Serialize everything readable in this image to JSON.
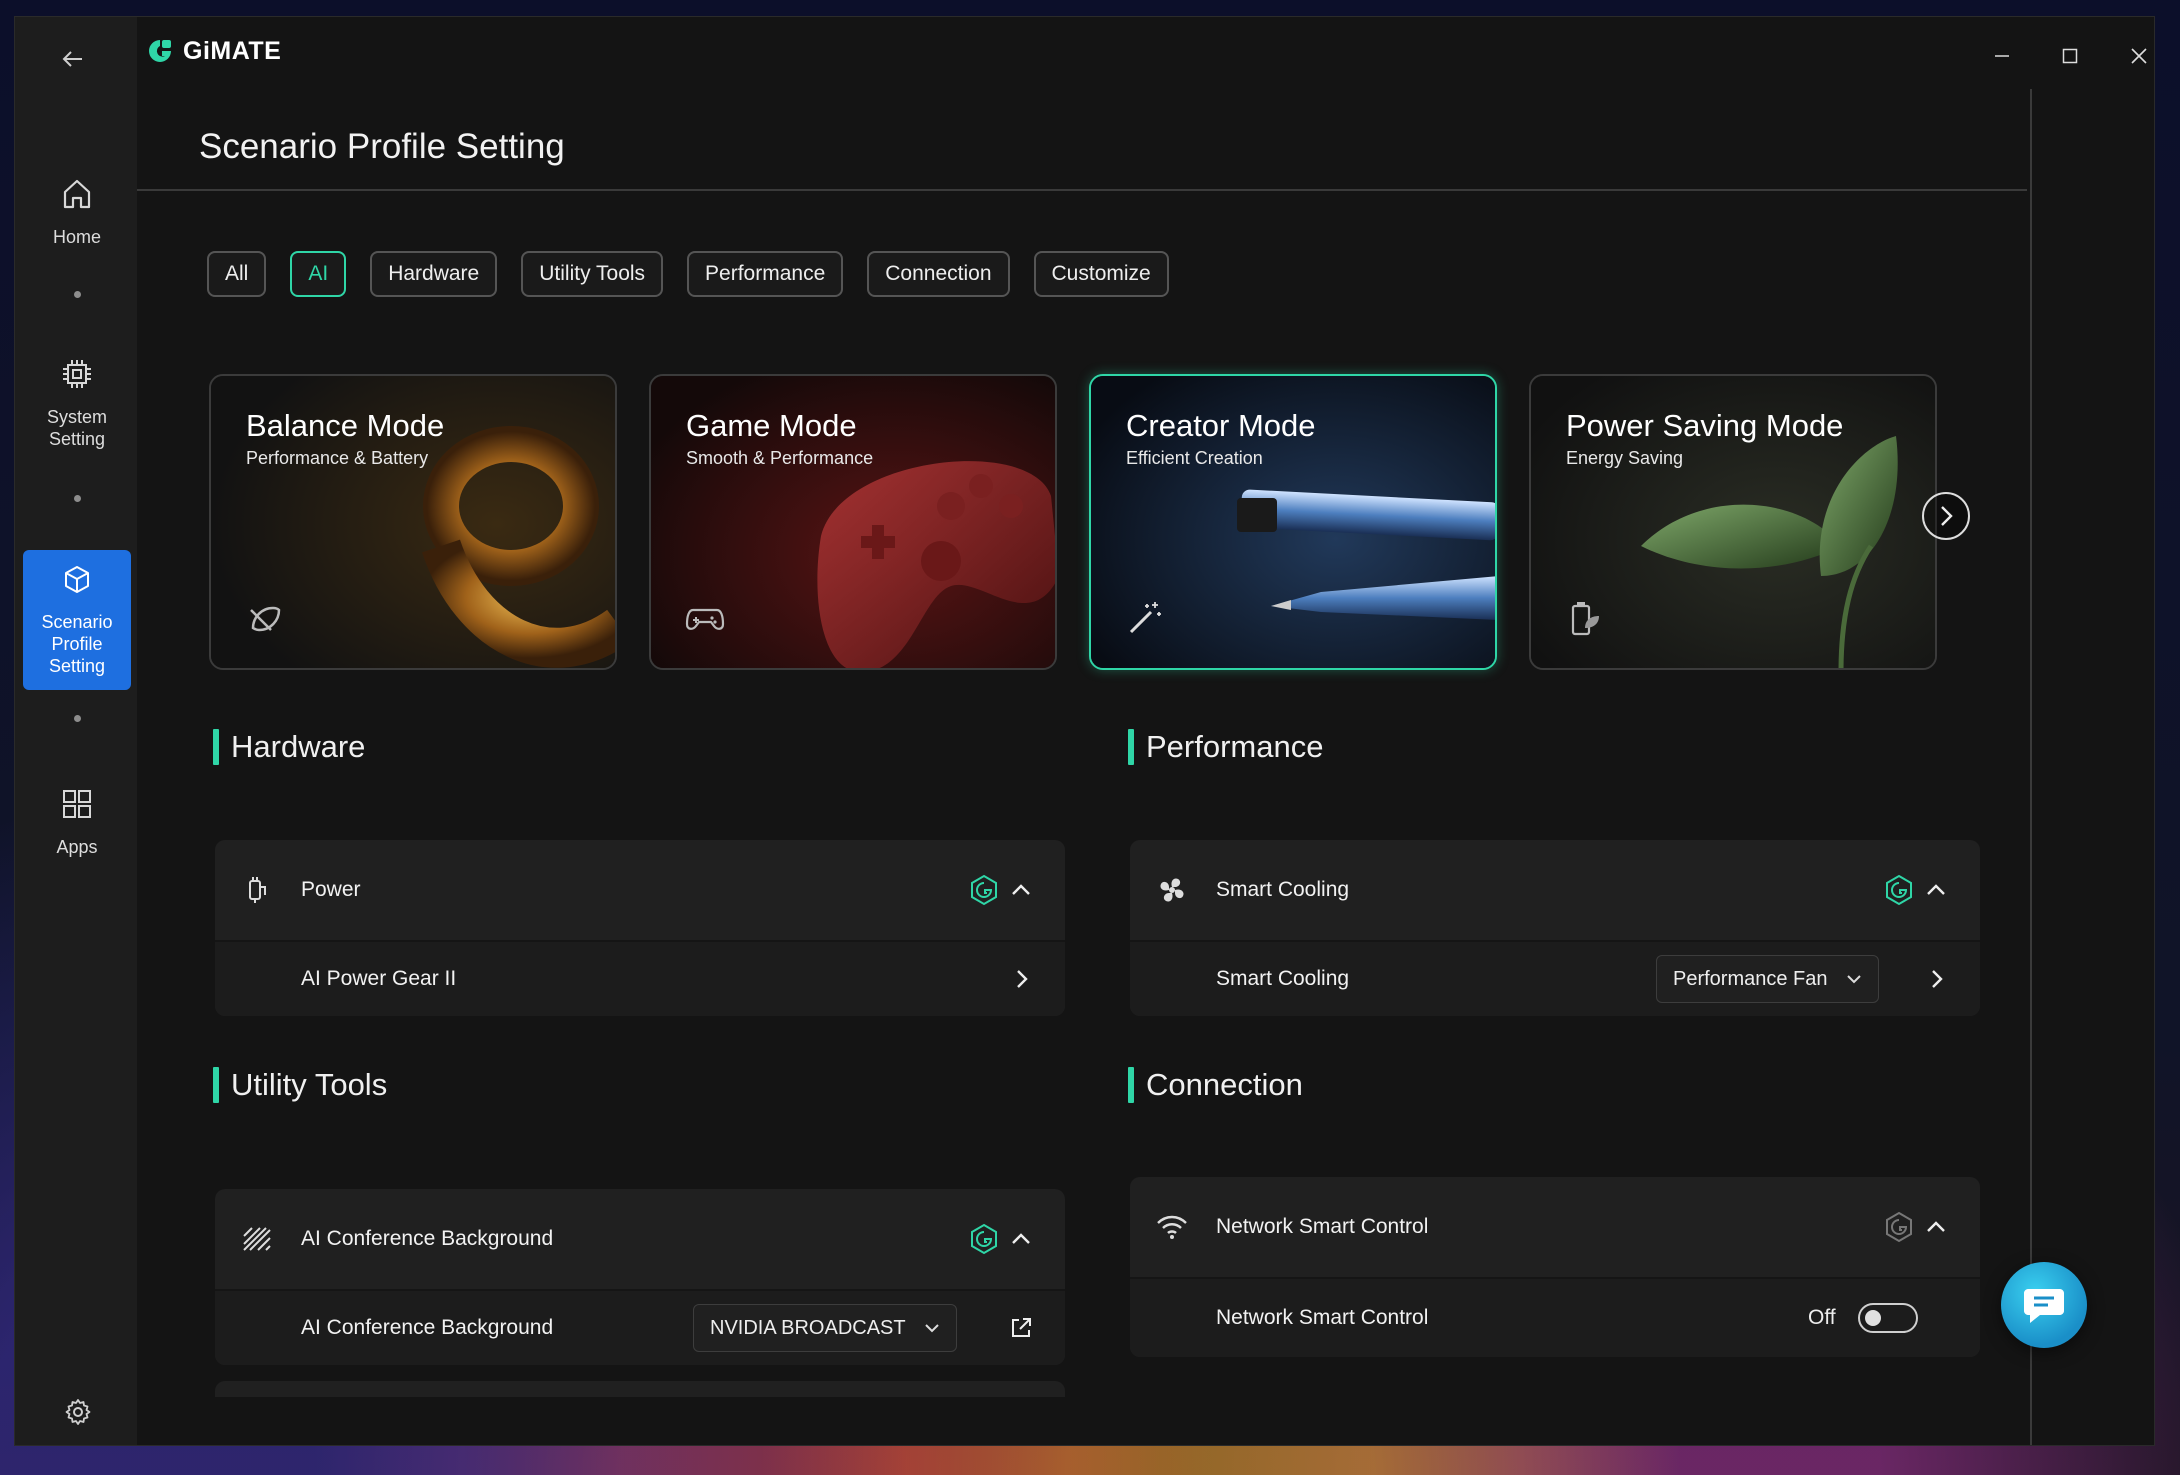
{
  "app": {
    "name": "GiMATE"
  },
  "window_controls": {
    "minimize": "minimize",
    "maximize": "maximize",
    "close": "close"
  },
  "sidebar": {
    "items": [
      {
        "label": "Home",
        "icon": "home-icon"
      },
      {
        "label": "System Setting",
        "icon": "chip-icon"
      },
      {
        "label": "Scenario Profile Setting",
        "icon": "cube-icon",
        "active": true
      },
      {
        "label": "Apps",
        "icon": "grid-icon"
      }
    ],
    "settings_icon": "gear-icon"
  },
  "page": {
    "title": "Scenario Profile Setting"
  },
  "filters": [
    {
      "label": "All"
    },
    {
      "label": "AI",
      "active": true
    },
    {
      "label": "Hardware"
    },
    {
      "label": "Utility Tools"
    },
    {
      "label": "Performance"
    },
    {
      "label": "Connection"
    },
    {
      "label": "Customize"
    }
  ],
  "modes": [
    {
      "title": "Balance Mode",
      "subtitle": "Performance & Battery",
      "icon": "balance-icon"
    },
    {
      "title": "Game Mode",
      "subtitle": "Smooth & Performance",
      "icon": "gamepad-icon"
    },
    {
      "title": "Creator Mode",
      "subtitle": "Efficient Creation",
      "icon": "magic-wand-icon",
      "active": true
    },
    {
      "title": "Power Saving Mode",
      "subtitle": "Energy Saving",
      "icon": "battery-leaf-icon"
    }
  ],
  "sections": {
    "hardware": {
      "title": "Hardware",
      "group_label": "Power",
      "row_label": "AI Power Gear II"
    },
    "performance": {
      "title": "Performance",
      "group_label": "Smart Cooling",
      "row_label": "Smart Cooling",
      "dropdown_value": "Performance Fan"
    },
    "utility": {
      "title": "Utility Tools",
      "group_label": "AI Conference Background",
      "row_label": "AI Conference Background",
      "dropdown_value": "NVIDIA BROADCAST"
    },
    "connection": {
      "title": "Connection",
      "group_label": "Network Smart Control",
      "row_label": "Network Smart Control",
      "toggle_state": "Off"
    }
  },
  "colors": {
    "accent": "#2fd6a7",
    "active_nav": "#1e6fe0",
    "background": "#141414"
  }
}
